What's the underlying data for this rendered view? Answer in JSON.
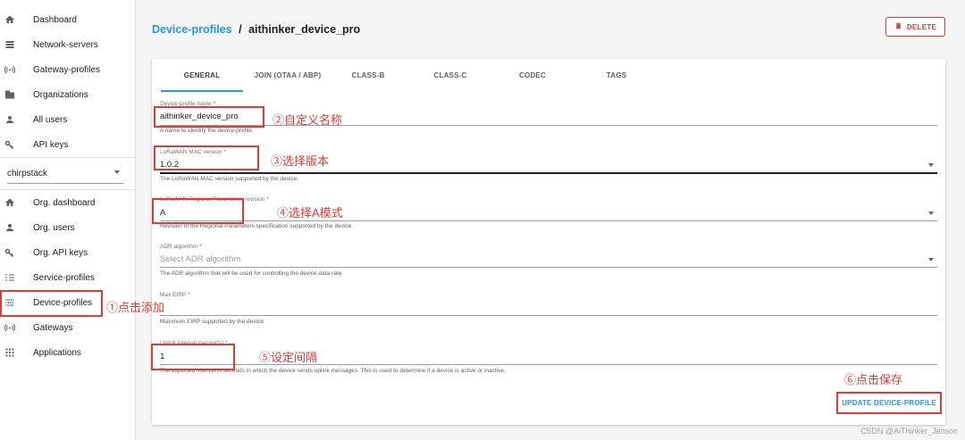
{
  "sidebar": {
    "top_items": [
      {
        "label": "Dashboard",
        "icon": "home-icon"
      },
      {
        "label": "Network-servers",
        "icon": "server-icon"
      },
      {
        "label": "Gateway-profiles",
        "icon": "wifi-icon"
      },
      {
        "label": "Organizations",
        "icon": "domain-icon"
      },
      {
        "label": "All users",
        "icon": "user-icon"
      },
      {
        "label": "API keys",
        "icon": "key-icon"
      }
    ],
    "org_select_value": "chirpstack",
    "org_items": [
      {
        "label": "Org. dashboard",
        "icon": "home-icon"
      },
      {
        "label": "Org. users",
        "icon": "user-icon"
      },
      {
        "label": "Org. API keys",
        "icon": "key-icon"
      },
      {
        "label": "Service-profiles",
        "icon": "list-icon"
      },
      {
        "label": "Device-profiles",
        "icon": "tune-icon"
      },
      {
        "label": "Gateways",
        "icon": "wifi-icon"
      },
      {
        "label": "Applications",
        "icon": "apps-icon"
      }
    ]
  },
  "header": {
    "breadcrumb_link": "Device-profiles",
    "breadcrumb_sep": "/",
    "breadcrumb_current": "aithinker_device_pro",
    "delete_label": "DELETE"
  },
  "tabs": [
    "GENERAL",
    "JOIN (OTAA / ABP)",
    "CLASS-B",
    "CLASS-C",
    "CODEC",
    "TAGS"
  ],
  "form": {
    "name": {
      "label": "Device-profile name *",
      "value": "aithinker_device_pro",
      "help": "A name to identify the device-profile."
    },
    "mac": {
      "label": "LoRaWAN MAC version *",
      "value": "1.0.2",
      "help": "The LoRaWAN MAC version supported by the device."
    },
    "regional": {
      "label": "LoRaWAN Regional Parameters revision *",
      "value": "A",
      "help": "Revision of the Regional Parameters specification supported by the device."
    },
    "adr": {
      "label": "ADR algorithm *",
      "placeholder": "Select ADR algorithm",
      "help": "The ADR algorithm that will be used for controlling the device data-rate."
    },
    "eirp": {
      "label": "Max EIRP *",
      "value": "",
      "help": "Maximum EIRP supported by the device."
    },
    "uplink": {
      "label": "Uplink interval (seconds) *",
      "value": "1",
      "help": "The expected interval in seconds in which the device sends uplink messages. This is used to determine if a device is active or inactive."
    }
  },
  "update_label": "UPDATE DEVICE-PROFILE",
  "annotations": {
    "a1": "①点击添加",
    "a2": "②自定义名称",
    "a3": "③选择版本",
    "a4": "④选择A模式",
    "a5": "⑤设定间隔",
    "a6": "⑥点击保存"
  },
  "watermark": "CSDN @AiThinker_Jenson",
  "colors": {
    "accent": "#2196f3",
    "danger": "#e53935",
    "annotation": "#e53935"
  }
}
